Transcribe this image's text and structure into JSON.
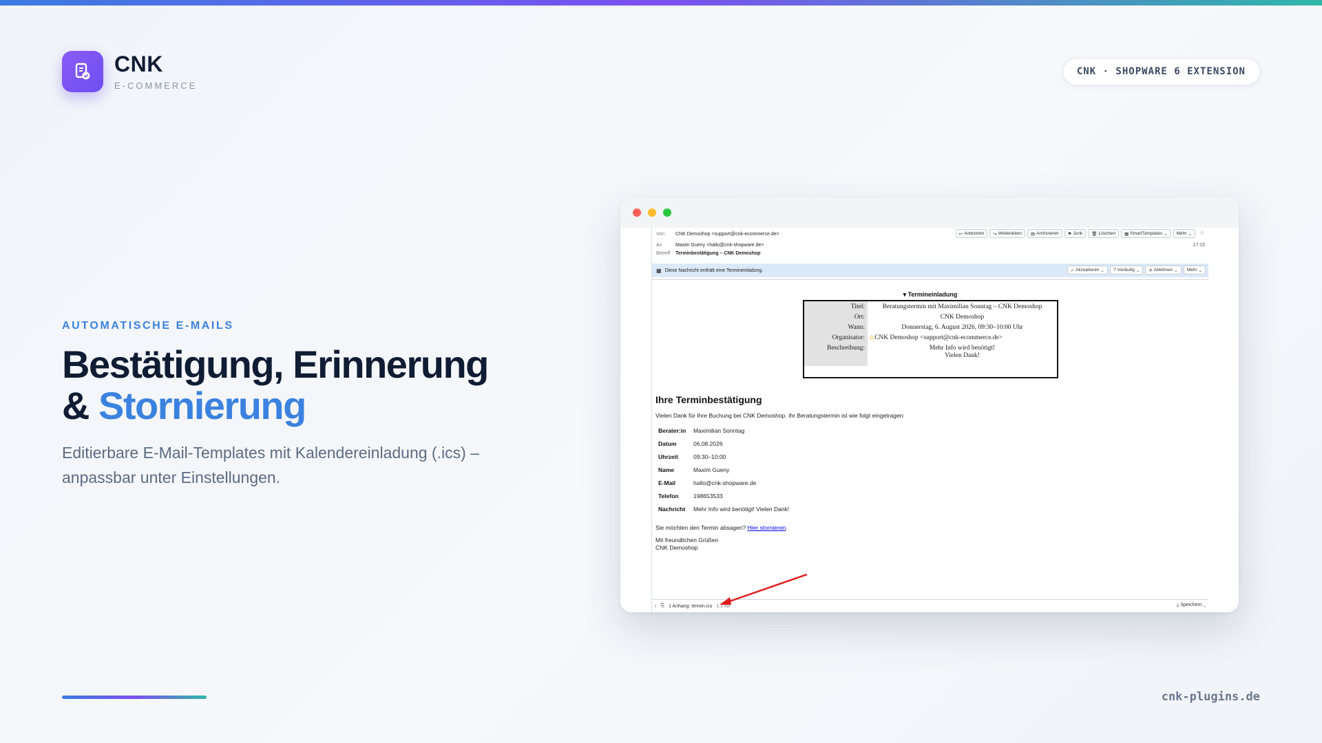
{
  "brand": {
    "name": "CNK",
    "sub": "E-COMMERCE"
  },
  "pill": "CNK · SHOPWARE 6 EXTENSION",
  "hero": {
    "eyebrow": "AUTOMATISCHE E-MAILS",
    "line1": "Bestätigung, Erinnerung",
    "line2_prefix": "& ",
    "line2_accent": "Stornierung",
    "subtext": "Editierbare E-Mail-Templates mit Kalendereinladung (.ics) – anpassbar unter Einstellungen."
  },
  "footer_url": "cnk-plugins.de",
  "mail": {
    "from_label": "Von",
    "from": "CNK Demoshop <support@cnk-ecommerce.de>",
    "to_label": "An",
    "to": "Maxim Gueny <hallo@cnk-shopware.de>",
    "subject_label": "Betreff",
    "subject": "Terminbestätigung – CNK Demoshop",
    "toolbar": [
      "Antworten",
      "Weiterleiten",
      "Archivieren",
      "Junk",
      "Löschen",
      "SmartTemplates",
      "Mehr"
    ],
    "time": "17:15",
    "invite_notice": "Diese Nachricht enthält eine Termineinladung.",
    "invite_buttons": [
      "Akzeptieren",
      "Vorläufig",
      "Ablehnen",
      "Mehr"
    ],
    "calendar": {
      "title": "▾ Termineinladung",
      "rows": [
        {
          "label": "Titel:",
          "value": "Beratungstermin mit Maximilian Sonntag – CNK Demoshop"
        },
        {
          "label": "Ort:",
          "value": "CNK Demoshop"
        },
        {
          "label": "Wann:",
          "value": "Donnerstag, 6. August 2026, 09:30–10:00 Uhr"
        },
        {
          "label": "Organisator:",
          "value": "CNK Demoshop <support@cnk-ecommerce.de>"
        }
      ],
      "desc_label": "Beschreibung:",
      "desc_line1": "Mehr Info wird benötigt!",
      "desc_line2": "Vielen Dank!"
    },
    "heading": "Ihre Terminbestätigung",
    "intro": "Vielen Dank für Ihre Buchung bei CNK Demoshop. Ihr Beratungstermin ist wie folgt eingetragen:",
    "details": [
      {
        "label": "Berater:in",
        "value": "Maximilian Sonntag"
      },
      {
        "label": "Datum",
        "value": "06.08.2026"
      },
      {
        "label": "Uhrzeit",
        "value": "09:30–10:00"
      },
      {
        "label": "Name",
        "value": "Maxim Gueny"
      },
      {
        "label": "E-Mail",
        "value": "hallo@cnk-shopware.de"
      },
      {
        "label": "Telefon",
        "value": "198653533"
      },
      {
        "label": "Nachricht",
        "value": "Mehr Info wird benötigt! Vielen Dank!"
      }
    ],
    "cancel_text": "Sie möchten den Termin absagen? ",
    "cancel_link": "Hier stornieren",
    "cancel_end": ".",
    "greeting": "Mit freundlichen Grüßen",
    "signature": "CNK Demoshop",
    "attachment": "1 Anhang: termin.ics",
    "attachment_size": "1,1 kB",
    "save": "Speichern"
  },
  "colors": {
    "accent": "#3b82e0",
    "logo": "#7b4ff0"
  }
}
